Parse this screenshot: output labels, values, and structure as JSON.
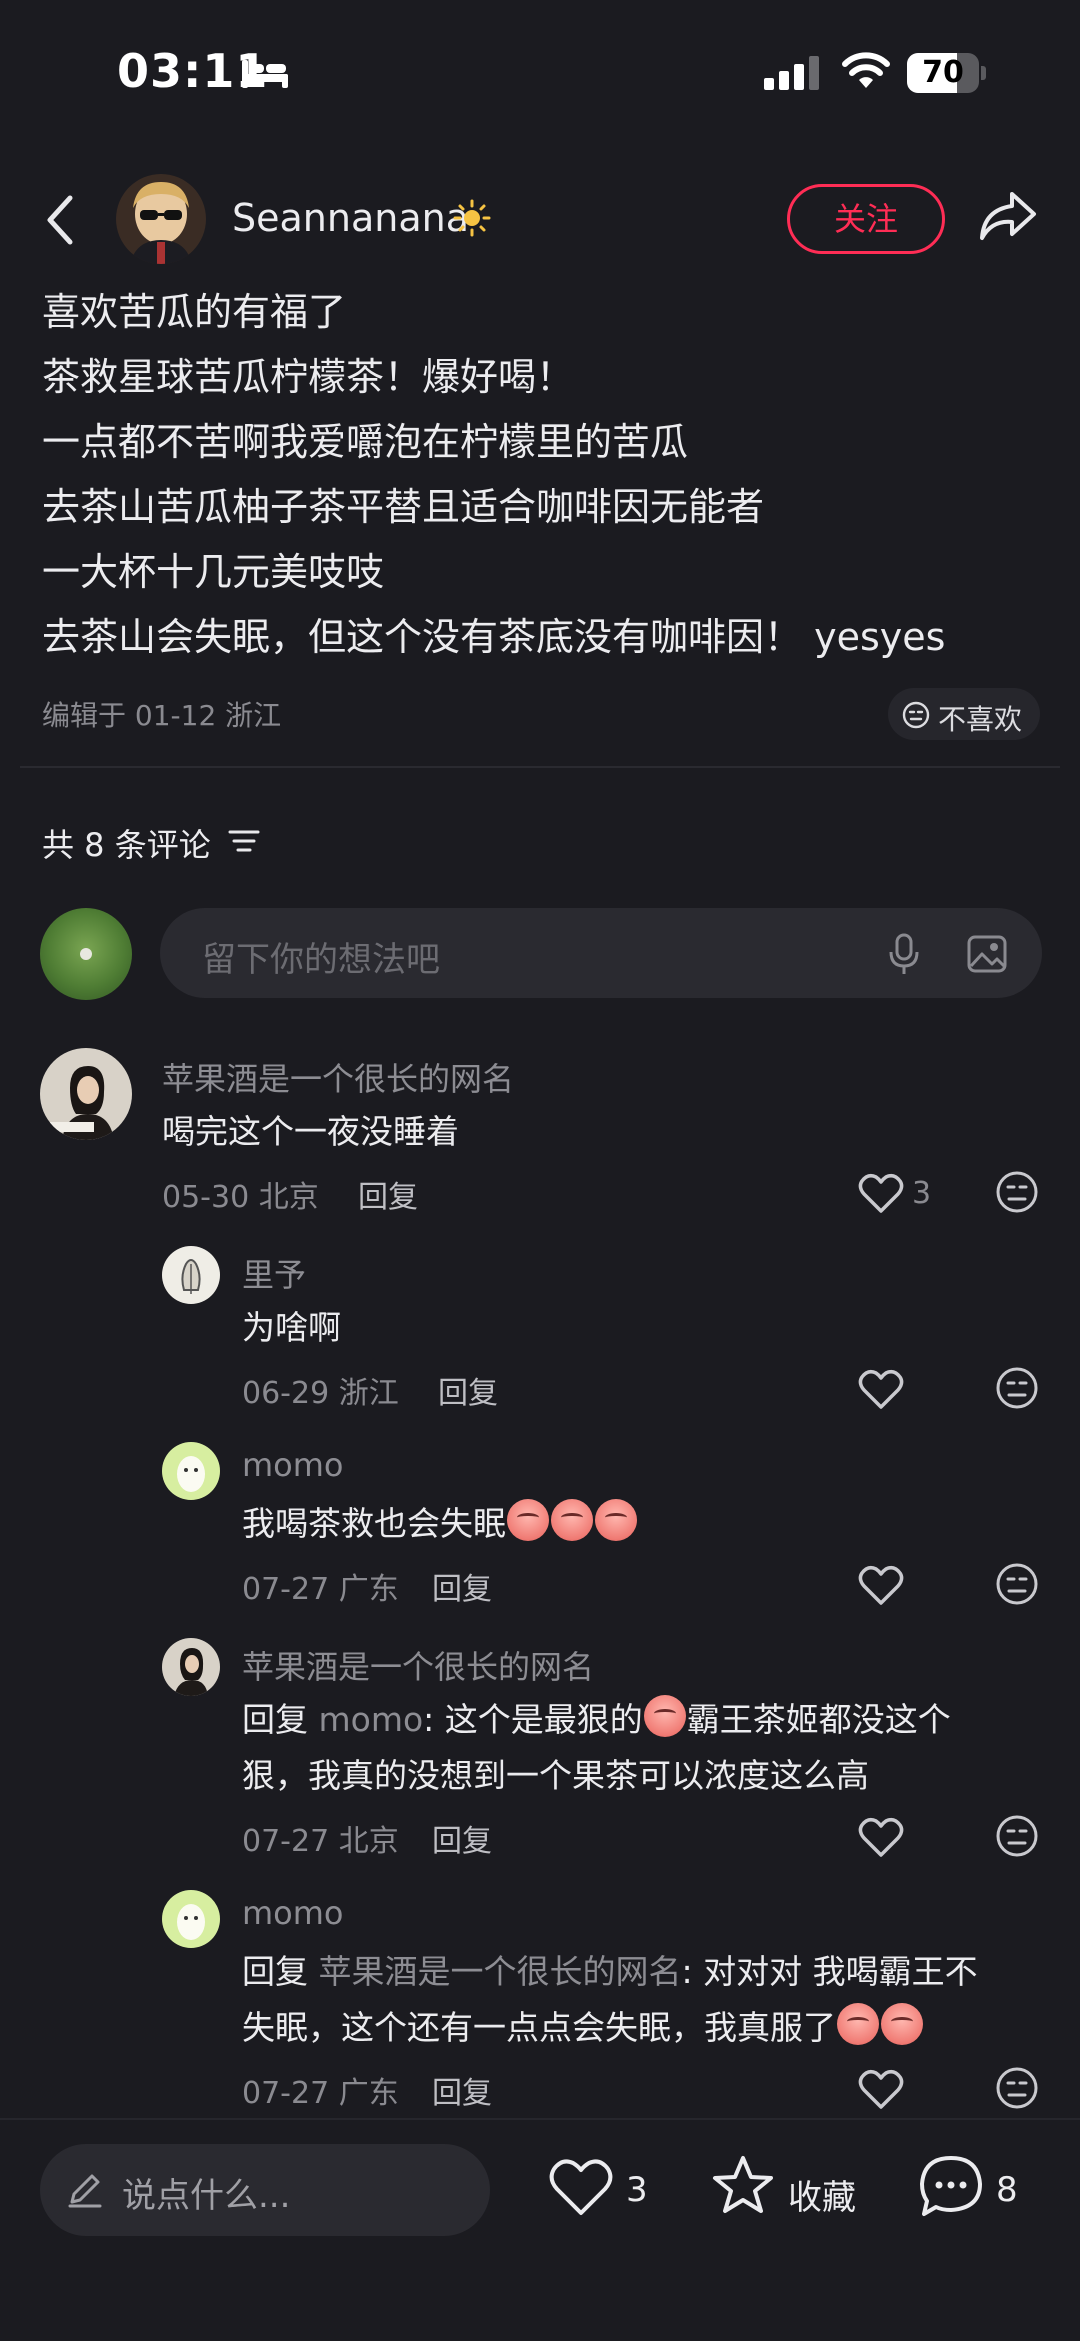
{
  "status_bar": {
    "time": "03:11",
    "battery": "70",
    "battery_level": 0.7
  },
  "header": {
    "author": "Seannanana",
    "follow_label": "关注"
  },
  "post": {
    "lines": [
      "喜欢苦瓜的有福了",
      "茶救星球苦瓜柠檬茶！爆好喝！",
      "一点都不苦啊我爱嚼泡在柠檬里的苦瓜",
      "去茶山苦瓜柚子茶平替且适合咖啡因无能者",
      "一大杯十几元美吱吱",
      "去茶山会失眠，但这个没有茶底没有咖啡因！ yesyes"
    ],
    "meta": "编辑于 01-12 浙江",
    "dislike_label": "不喜欢"
  },
  "comments_header": {
    "count_label": "共 8 条评论"
  },
  "comment_input": {
    "placeholder": "留下你的想法吧"
  },
  "comments": [
    {
      "name": "苹果酒是一个很长的网名",
      "text": "喝完这个一夜没睡着",
      "date_loc": "05-30 北京",
      "reply": "回复",
      "likes": "3"
    },
    {
      "name": "里予",
      "text": "为啥啊",
      "date_loc": "06-29 浙江",
      "reply": "回复",
      "likes": ""
    },
    {
      "name": "momo",
      "text": "我喝茶救也会失眠",
      "date_loc": "07-27 广东",
      "reply": "回复",
      "likes": ""
    },
    {
      "name": "苹果酒是一个很长的网名",
      "reply_prefix": "回复 ",
      "mention": "momo",
      "text_a": ": 这个是最狠的",
      "text_b": "霸王茶姬都没这个",
      "text_line2": "狠，我真的没想到一个果茶可以浓度这么高",
      "date_loc": "07-27 北京",
      "reply": "回复",
      "likes": ""
    },
    {
      "name": "momo",
      "reply_prefix": "回复 ",
      "mention": "苹果酒是一个很长的网名",
      "text_a": ": 对对对 我喝霸王不",
      "text_line2": "失眠，这个还有一点点会失眠，我真服了",
      "date_loc": "07-27 广东",
      "reply": "回复",
      "likes": ""
    }
  ],
  "bottom_bar": {
    "say_placeholder": "说点什么...",
    "like_count": "3",
    "collect_label": "收藏",
    "comment_count": "8"
  },
  "colors": {
    "background": "#1b1b20",
    "accent": "#ff2d55",
    "muted_text": "#8a8a90"
  }
}
